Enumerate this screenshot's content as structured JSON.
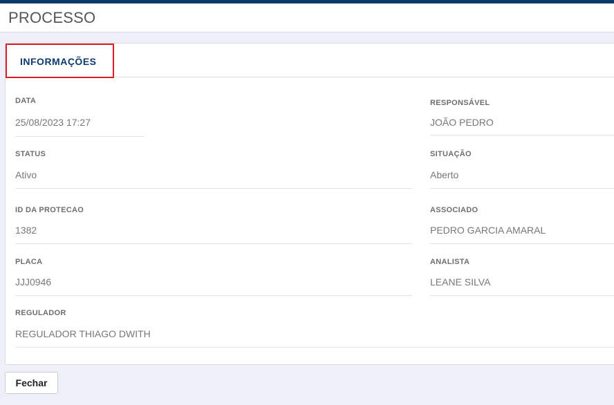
{
  "page": {
    "title": "PROCESSO"
  },
  "tabs": [
    {
      "label": "INFORMAÇÕES",
      "active": true
    }
  ],
  "fields": {
    "data": {
      "label": "DATA",
      "value": "25/08/2023 17:27"
    },
    "responsavel": {
      "label": "RESPONSÁVEL",
      "value": "JOÃO PEDRO"
    },
    "status": {
      "label": "STATUS",
      "value": "Ativo"
    },
    "situacao": {
      "label": "SITUAÇÃO",
      "value": "Aberto"
    },
    "id_protecao": {
      "label": "ID DA PROTECAO",
      "value": "1382"
    },
    "associado": {
      "label": "ASSOCIADO",
      "value": "PEDRO GARCIA AMARAL"
    },
    "placa": {
      "label": "PLACA",
      "value": "JJJ0946"
    },
    "analista": {
      "label": "ANALISTA",
      "value": "LEANE SILVA"
    },
    "regulador": {
      "label": "REGULADOR",
      "value": "REGULADOR THIAGO DWITH"
    }
  },
  "actions": {
    "close_label": "Fechar"
  },
  "colors": {
    "topbar": "#0d3a6e",
    "tab_text": "#0d3a6e",
    "tab_highlight": "#e01b24",
    "background": "#eeeff8"
  }
}
